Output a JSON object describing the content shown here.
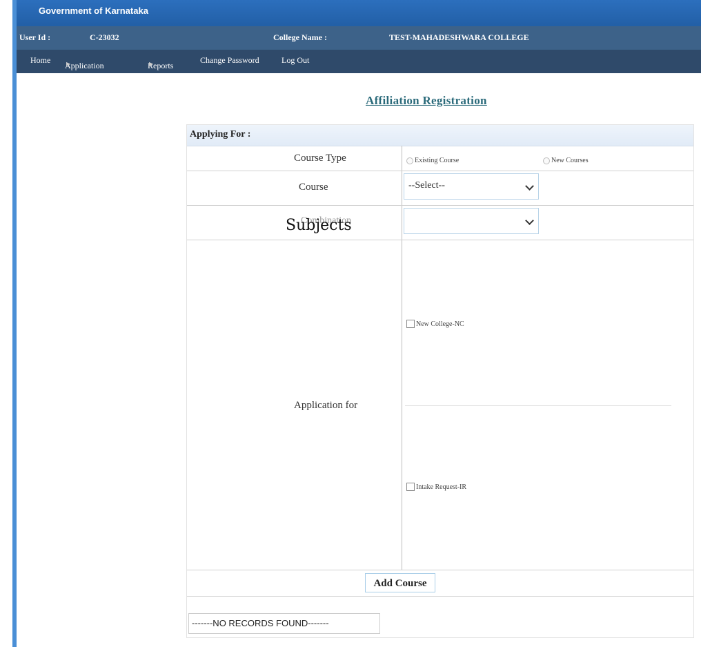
{
  "header": {
    "gov_title": "Government of Karnataka",
    "user_id_label": "User Id :",
    "user_id_value": "C-23032",
    "college_label": "College Name :",
    "college_value": "TEST-MAHADESHWARA COLLEGE"
  },
  "nav": {
    "items": [
      {
        "label": "Home"
      },
      {
        "label": "Application"
      },
      {
        "label": "Reports"
      },
      {
        "label": "Change Password"
      },
      {
        "label": "Log Out"
      }
    ]
  },
  "page": {
    "heading": "Affiliation Registration"
  },
  "form": {
    "section_title": "Applying For :",
    "course_type_label": "Course Type",
    "course_type_options": [
      "Existing Course",
      "New Courses"
    ],
    "course_label": "Course",
    "course_select_value": "--Select--",
    "combination_label": "Combination",
    "subjects_overlay": "Subjects",
    "combination_select_value": "",
    "application_for_label": "Application for",
    "application_options": [
      "New College-NC",
      "Intake Request-IR"
    ],
    "add_course_label": "Add Course",
    "no_records_text": "-------NO RECORDS FOUND-------"
  },
  "colors": {
    "gov_bar": "#2c6fbd",
    "info_bar": "#3d6289",
    "nav_bar": "#2f4a6a",
    "heading": "#2a6a7a",
    "section_bg": "#e1ebf7"
  }
}
